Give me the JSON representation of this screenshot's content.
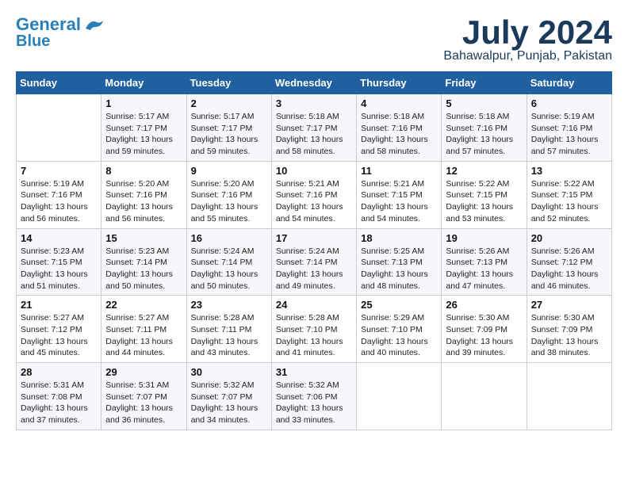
{
  "logo": {
    "line1": "General",
    "line2": "Blue"
  },
  "title": {
    "month_year": "July 2024",
    "location": "Bahawalpur, Punjab, Pakistan"
  },
  "days_of_week": [
    "Sunday",
    "Monday",
    "Tuesday",
    "Wednesday",
    "Thursday",
    "Friday",
    "Saturday"
  ],
  "weeks": [
    [
      {
        "num": "",
        "info": ""
      },
      {
        "num": "1",
        "info": "Sunrise: 5:17 AM\nSunset: 7:17 PM\nDaylight: 13 hours\nand 59 minutes."
      },
      {
        "num": "2",
        "info": "Sunrise: 5:17 AM\nSunset: 7:17 PM\nDaylight: 13 hours\nand 59 minutes."
      },
      {
        "num": "3",
        "info": "Sunrise: 5:18 AM\nSunset: 7:17 PM\nDaylight: 13 hours\nand 58 minutes."
      },
      {
        "num": "4",
        "info": "Sunrise: 5:18 AM\nSunset: 7:16 PM\nDaylight: 13 hours\nand 58 minutes."
      },
      {
        "num": "5",
        "info": "Sunrise: 5:18 AM\nSunset: 7:16 PM\nDaylight: 13 hours\nand 57 minutes."
      },
      {
        "num": "6",
        "info": "Sunrise: 5:19 AM\nSunset: 7:16 PM\nDaylight: 13 hours\nand 57 minutes."
      }
    ],
    [
      {
        "num": "7",
        "info": "Sunrise: 5:19 AM\nSunset: 7:16 PM\nDaylight: 13 hours\nand 56 minutes."
      },
      {
        "num": "8",
        "info": "Sunrise: 5:20 AM\nSunset: 7:16 PM\nDaylight: 13 hours\nand 56 minutes."
      },
      {
        "num": "9",
        "info": "Sunrise: 5:20 AM\nSunset: 7:16 PM\nDaylight: 13 hours\nand 55 minutes."
      },
      {
        "num": "10",
        "info": "Sunrise: 5:21 AM\nSunset: 7:16 PM\nDaylight: 13 hours\nand 54 minutes."
      },
      {
        "num": "11",
        "info": "Sunrise: 5:21 AM\nSunset: 7:15 PM\nDaylight: 13 hours\nand 54 minutes."
      },
      {
        "num": "12",
        "info": "Sunrise: 5:22 AM\nSunset: 7:15 PM\nDaylight: 13 hours\nand 53 minutes."
      },
      {
        "num": "13",
        "info": "Sunrise: 5:22 AM\nSunset: 7:15 PM\nDaylight: 13 hours\nand 52 minutes."
      }
    ],
    [
      {
        "num": "14",
        "info": "Sunrise: 5:23 AM\nSunset: 7:15 PM\nDaylight: 13 hours\nand 51 minutes."
      },
      {
        "num": "15",
        "info": "Sunrise: 5:23 AM\nSunset: 7:14 PM\nDaylight: 13 hours\nand 50 minutes."
      },
      {
        "num": "16",
        "info": "Sunrise: 5:24 AM\nSunset: 7:14 PM\nDaylight: 13 hours\nand 50 minutes."
      },
      {
        "num": "17",
        "info": "Sunrise: 5:24 AM\nSunset: 7:14 PM\nDaylight: 13 hours\nand 49 minutes."
      },
      {
        "num": "18",
        "info": "Sunrise: 5:25 AM\nSunset: 7:13 PM\nDaylight: 13 hours\nand 48 minutes."
      },
      {
        "num": "19",
        "info": "Sunrise: 5:26 AM\nSunset: 7:13 PM\nDaylight: 13 hours\nand 47 minutes."
      },
      {
        "num": "20",
        "info": "Sunrise: 5:26 AM\nSunset: 7:12 PM\nDaylight: 13 hours\nand 46 minutes."
      }
    ],
    [
      {
        "num": "21",
        "info": "Sunrise: 5:27 AM\nSunset: 7:12 PM\nDaylight: 13 hours\nand 45 minutes."
      },
      {
        "num": "22",
        "info": "Sunrise: 5:27 AM\nSunset: 7:11 PM\nDaylight: 13 hours\nand 44 minutes."
      },
      {
        "num": "23",
        "info": "Sunrise: 5:28 AM\nSunset: 7:11 PM\nDaylight: 13 hours\nand 43 minutes."
      },
      {
        "num": "24",
        "info": "Sunrise: 5:28 AM\nSunset: 7:10 PM\nDaylight: 13 hours\nand 41 minutes."
      },
      {
        "num": "25",
        "info": "Sunrise: 5:29 AM\nSunset: 7:10 PM\nDaylight: 13 hours\nand 40 minutes."
      },
      {
        "num": "26",
        "info": "Sunrise: 5:30 AM\nSunset: 7:09 PM\nDaylight: 13 hours\nand 39 minutes."
      },
      {
        "num": "27",
        "info": "Sunrise: 5:30 AM\nSunset: 7:09 PM\nDaylight: 13 hours\nand 38 minutes."
      }
    ],
    [
      {
        "num": "28",
        "info": "Sunrise: 5:31 AM\nSunset: 7:08 PM\nDaylight: 13 hours\nand 37 minutes."
      },
      {
        "num": "29",
        "info": "Sunrise: 5:31 AM\nSunset: 7:07 PM\nDaylight: 13 hours\nand 36 minutes."
      },
      {
        "num": "30",
        "info": "Sunrise: 5:32 AM\nSunset: 7:07 PM\nDaylight: 13 hours\nand 34 minutes."
      },
      {
        "num": "31",
        "info": "Sunrise: 5:32 AM\nSunset: 7:06 PM\nDaylight: 13 hours\nand 33 minutes."
      },
      {
        "num": "",
        "info": ""
      },
      {
        "num": "",
        "info": ""
      },
      {
        "num": "",
        "info": ""
      }
    ]
  ]
}
